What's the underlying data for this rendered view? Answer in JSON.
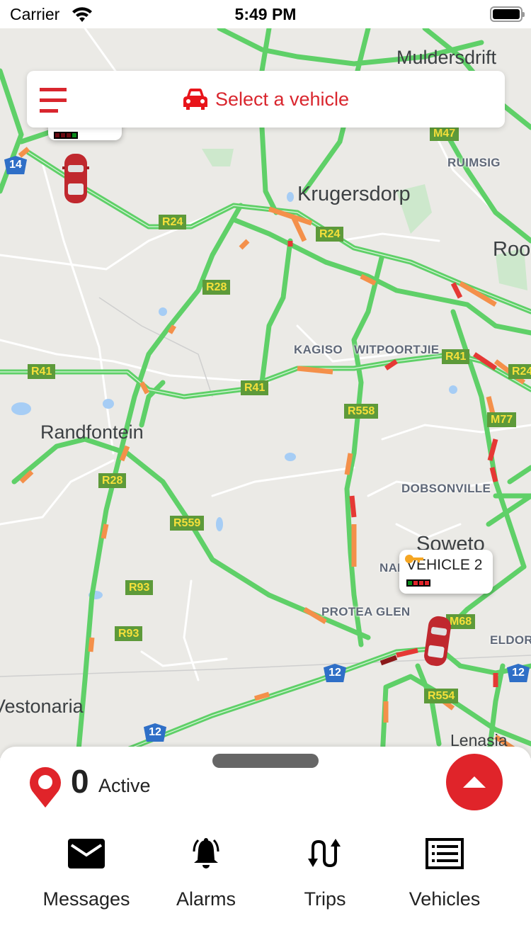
{
  "status_bar": {
    "carrier": "Carrier",
    "time": "5:49 PM",
    "icons": [
      "wifi-icon",
      "battery-icon"
    ]
  },
  "top_bar": {
    "menu_icon": "hamburger-menu-icon",
    "select_vehicle_icon": "car-icon",
    "select_vehicle_label": "Select a vehicle",
    "accent_color": "#d9262e"
  },
  "map": {
    "places": {
      "muldersdrift": "Muldersdrift",
      "krugersdorp": "Krugersdorp",
      "roodepoort": "Roo",
      "ruimsig": "RUIMSIG",
      "kagiso": "KAGISO",
      "witpoortjie": "WITPOORTJIE",
      "randfontein": "Randfontein",
      "dobsonville": "DOBSONVILLE",
      "soweto": "Soweto",
      "naledi": "NAI",
      "protea_glen": "PROTEA GLEN",
      "eldorado": "ELDOR",
      "westonaria": "Vestonaria",
      "lenasia": "Lenasia"
    },
    "routes": {
      "r24_a": "R24",
      "r24_b": "R24",
      "r24_c": "R24",
      "r28_a": "R28",
      "r28_b": "R28",
      "r41_a": "R41",
      "r41_b": "R41",
      "r41_c": "R41",
      "r558": "R558",
      "r559": "R559",
      "r93_a": "R93",
      "r93_b": "R93",
      "m47": "M47",
      "m77": "M77",
      "m68": "M68",
      "r554": "R554",
      "n14": "14",
      "n12_a": "12",
      "n12_b": "12",
      "n12_c": "12"
    },
    "vehicles": [
      {
        "name": "VEHICLE 2",
        "signal": [
          "#0a8a1a",
          "#e0242a",
          "#e0242a",
          "#e0242a"
        ],
        "ignition_icon": "key-icon",
        "ignition_color": "#f5a623"
      },
      {
        "name": "",
        "signal": [
          "#6a0a12",
          "#6a0a12",
          "#6a0a12",
          "#0a8a1a"
        ],
        "ignition_icon": "key-icon",
        "ignition_color": "#f5a623"
      }
    ],
    "traffic_colors": {
      "free": "#5fd068",
      "slow": "#f4904a",
      "heavy": "#e53935",
      "jam": "#8b1a1a"
    }
  },
  "bottom_sheet": {
    "active_count": "0",
    "active_label": "Active",
    "expand_icon": "chevron-up-icon",
    "nav": [
      {
        "label": "Messages",
        "icon": "envelope-icon"
      },
      {
        "label": "Alarms",
        "icon": "bell-ringing-icon"
      },
      {
        "label": "Trips",
        "icon": "trips-arrows-icon"
      },
      {
        "label": "Vehicles",
        "icon": "list-icon"
      }
    ]
  }
}
